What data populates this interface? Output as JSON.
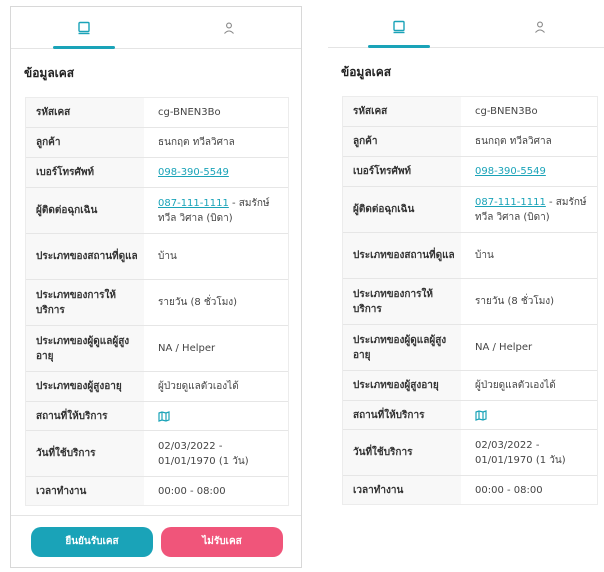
{
  "colors": {
    "accent": "#1aa3b8",
    "reject": "#f0557a",
    "label_bg": "#f8f8f8"
  },
  "tabs": [
    {
      "icon": "notebook-icon",
      "active": true
    },
    {
      "icon": "user-icon",
      "active": false
    }
  ],
  "section_title": "ข้อมูลเคส",
  "case": {
    "rows": [
      {
        "label": "รหัสเคส",
        "value": "cg-BNEN3Bo"
      },
      {
        "label": "ลูกค้า",
        "value": "ธนกฤต ทวีลวิศาล"
      },
      {
        "label": "เบอร์โทรศัพท์",
        "value": "098-390-5549"
      },
      {
        "label": "ผู้ติดต่อฉุกเฉิน",
        "phone": "087-111-1111",
        "value": " - สมรักษ์ ทวีล วิศาล (บิดา)"
      },
      {
        "label": "ประเภทของสถานที่ดูแล",
        "value": "บ้าน"
      },
      {
        "label": "ประเภทของการให้บริการ",
        "value": "รายวัน (8 ชั่วโมง)"
      },
      {
        "label": "ประเภทของผู้ดูแลผู้สูงอายุ",
        "value": "NA / Helper"
      },
      {
        "label": "ประเภทของผู้สูงอายุ",
        "value": "ผู้ป่วยดูแลตัวเองได้"
      },
      {
        "label": "สถานที่ให้บริการ",
        "icon": "map-icon"
      },
      {
        "label": "วันที่ใช้บริการ",
        "value": "02/03/2022 - 01/01/1970 (1 วัน)"
      },
      {
        "label": "เวลาทำงาน",
        "value": "00:00 - 08:00"
      }
    ]
  },
  "actions": {
    "accept_label": "ยืนยันรับเคส",
    "reject_label": "ไม่รับเคส"
  }
}
